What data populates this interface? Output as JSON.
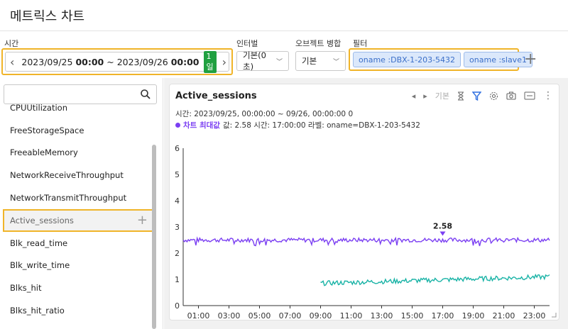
{
  "page": {
    "title": "메트릭스 차트"
  },
  "toolbar": {
    "time_label": "시간",
    "start_date": "2023/09/25",
    "start_time": "00:00",
    "range_sep": "~",
    "end_date": "2023/09/26",
    "end_time": "00:00",
    "day_badge": "1일",
    "interval_label": "인터벌",
    "interval_value": "기본(0초)",
    "merge_label": "오브젝트 병합",
    "merge_value": "기본",
    "filter_label": "필터",
    "filters": [
      "oname :DBX-1-203-5432",
      "oname :slave1"
    ]
  },
  "metrics": [
    "CPUUtilization",
    "FreeStorageSpace",
    "FreeableMemory",
    "NetworkReceiveThroughput",
    "NetworkTransmitThroughput",
    "Active_sessions",
    "Blk_read_time",
    "Blk_write_time",
    "Blks_hit",
    "Blks_hit_ratio"
  ],
  "selected_metric": "Active_sessions",
  "chart_card": {
    "title": "Active_sessions",
    "nav_label": "기본",
    "info_line": "시간: 2023/09/25, 00:00:00 ~ 09/26, 00:00:00   0",
    "tooltip_lead": "차트 최대값",
    "tooltip_rest": "값: 2.58   시간: 17:00:00   라벨: oname=DBX-1-203-5432"
  },
  "chart_data": {
    "type": "line",
    "x_ticks": [
      "01:00",
      "03:00",
      "05:00",
      "07:00",
      "09:00",
      "11:00",
      "13:00",
      "15:00",
      "17:00",
      "19:00",
      "21:00",
      "23:00"
    ],
    "ylim": [
      0,
      6
    ],
    "y_ticks": [
      0,
      1,
      2,
      3,
      4,
      5,
      6
    ],
    "series": [
      {
        "color": "#7b3ff2",
        "x_start_hour": 0,
        "x_end_hour": 24,
        "approx_level": 2.5,
        "noise": 0.08
      },
      {
        "color": "#19b3a6",
        "x_start_hour": 9,
        "x_end_hour": 24,
        "start_level": 0.85,
        "end_level": 1.1,
        "noise": 0.09
      }
    ],
    "annotation": {
      "label": "2.58",
      "x_hour": 17,
      "y": 2.58
    }
  }
}
